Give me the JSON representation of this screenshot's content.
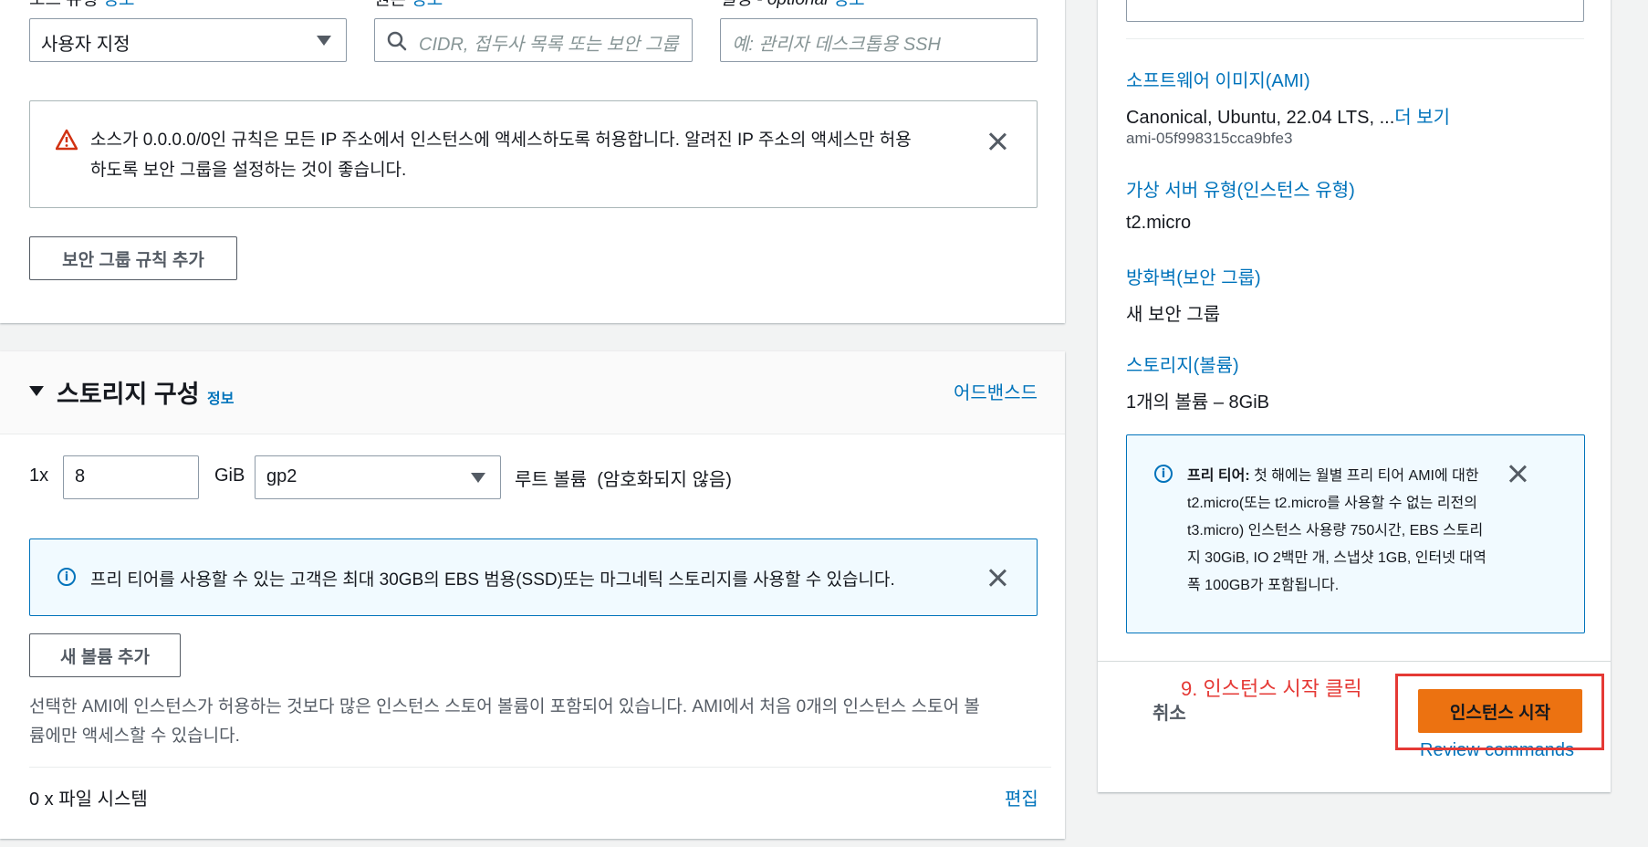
{
  "security_rule": {
    "source_type_label": "소스 유형",
    "source_type_info": "정보",
    "source_label": "원본",
    "source_info": "정보",
    "description_label": "설명 - optional",
    "description_info": "정보",
    "source_type_value": "사용자 지정",
    "source_placeholder": "CIDR, 접두사 목록 또는 보안 그룹",
    "description_placeholder": "예: 관리자 데스크톱용 SSH"
  },
  "warning_alert": {
    "line1": "소스가 0.0.0.0/0인 규칙은 모든 IP 주소에서 인스턴스에 액세스하도록 허용합니다. 알려진 IP 주소의 액세스만 허용",
    "line2": "하도록 보안 그룹을 설정하는 것이 좋습니다."
  },
  "add_rule_button": "보안 그룹 규칙 추가",
  "storage": {
    "title": "스토리지 구성",
    "info": "정보",
    "advanced": "어드밴스드",
    "count_prefix": "1x",
    "size_value": "8",
    "unit": "GiB",
    "volume_type": "gp2",
    "root_label": "루트 볼륨  (암호화되지 않음)",
    "info_alert": "프리 티어를 사용할 수 있는 고객은 최대 30GB의 EBS 범용(SSD)또는 마그네틱 스토리지를 사용할 수 있습니다.",
    "add_volume_button": "새 볼륨 추가",
    "note_line1": "선택한 AMI에 인스턴스가 허용하는 것보다 많은 인스턴스 스토어 볼륨이 포함되어 있습니다. AMI에서 처음 0개의 인스턴스 스토어 볼",
    "note_line2": "륨에만 액세스할 수 있습니다.",
    "filesystems": "0 x 파일 시스템",
    "edit": "편집"
  },
  "summary": {
    "ami_label": "소프트웨어 이미지(AMI)",
    "ami_value": "Canonical, Ubuntu, 22.04 LTS, ...",
    "ami_more": "더 보기",
    "ami_id": "ami-05f998315cca9bfe3",
    "type_label": "가상 서버 유형(인스턴스 유형)",
    "type_value": "t2.micro",
    "firewall_label": "방화벽(보안 그룹)",
    "firewall_value": "새 보안 그룹",
    "storage_label": "스토리지(볼륨)",
    "storage_value": "1개의 볼륨 – 8GiB",
    "free_tier_bold": "프리 티어:",
    "free_tier_lines": [
      " 첫 해에는 월별 프리 티어 AMI에 대한",
      "t2.micro(또는 t2.micro를 사용할 수 없는 리전의",
      "t3.micro) 인스턴스 사용량 750시간, EBS 스토리",
      "지 30GiB, IO 2백만 개, 스냅샷 1GB, 인터넷 대역",
      "폭 100GB가 포함됩니다."
    ],
    "cancel": "취소",
    "launch": "인스턴스 시작",
    "review": "Review commands",
    "annotation": "9. 인스턴스 시작 클릭"
  },
  "colors": {
    "link": "#0073bb",
    "primary": "#ec7211",
    "annotation": "#e53935",
    "info_bg": "#f1faff",
    "warning": "#d13212"
  }
}
